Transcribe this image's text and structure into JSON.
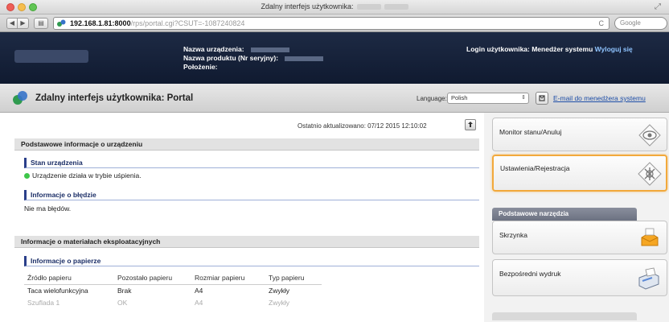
{
  "window": {
    "title": "Zdalny interfejs użytkownika:"
  },
  "browser": {
    "url_host": "192.168.1.81:8000",
    "url_path": "/rps/portal.cgi?CSUT=-1087240824",
    "reload_symbol": "C",
    "search_placeholder": "Google"
  },
  "header": {
    "device_name_label": "Nazwa urządzenia:",
    "product_name_label": "Nazwa produktu (Nr seryjny):",
    "location_label": "Położenie:",
    "login_prefix": "Login użytkownika: Menedżer systemu",
    "logout_label": "Wyloguj się"
  },
  "portal": {
    "title": "Zdalny interfejs użytkownika: Portal",
    "language_label": "Language:",
    "language_value": "Polish",
    "email_link": "E-mail do menedżera systemu"
  },
  "main": {
    "last_updated": "Ostatnio aktualizowano: 07/12 2015 12:10:02",
    "device_info_heading": "Podstawowe informacje o urządzeniu",
    "device_status_heading": "Stan urządzenia",
    "device_status_text": "Urządzenie działa w trybie uśpienia.",
    "error_info_heading": "Informacje o błędzie",
    "error_info_text": "Nie ma błędów.",
    "consumables_heading": "Informacje o materiałach eksploatacyjnych",
    "paper_info_heading": "Informacje o papierze",
    "paper_table": {
      "headers": [
        "Źródło papieru",
        "Pozostało papieru",
        "Rozmiar papieru",
        "Typ papieru"
      ],
      "rows": [
        [
          "Taca wielofunkcyjna",
          "Brak",
          "A4",
          "Zwykły"
        ],
        [
          "Szuflada 1",
          "OK",
          "A4",
          "Zwykły"
        ]
      ]
    }
  },
  "sidebar": {
    "monitor_label": "Monitor stanu/Anuluj",
    "settings_label": "Ustawienia/Rejestracja",
    "tools_heading": "Podstawowe narzędzia",
    "mailbox_label": "Skrzynka",
    "direct_print_label": "Bezpośredni wydruk"
  },
  "colors": {
    "header_bg": "#15213a",
    "highlight": "#f2a93b",
    "link": "#1f4fa8",
    "status_ok": "#3ec64a"
  }
}
